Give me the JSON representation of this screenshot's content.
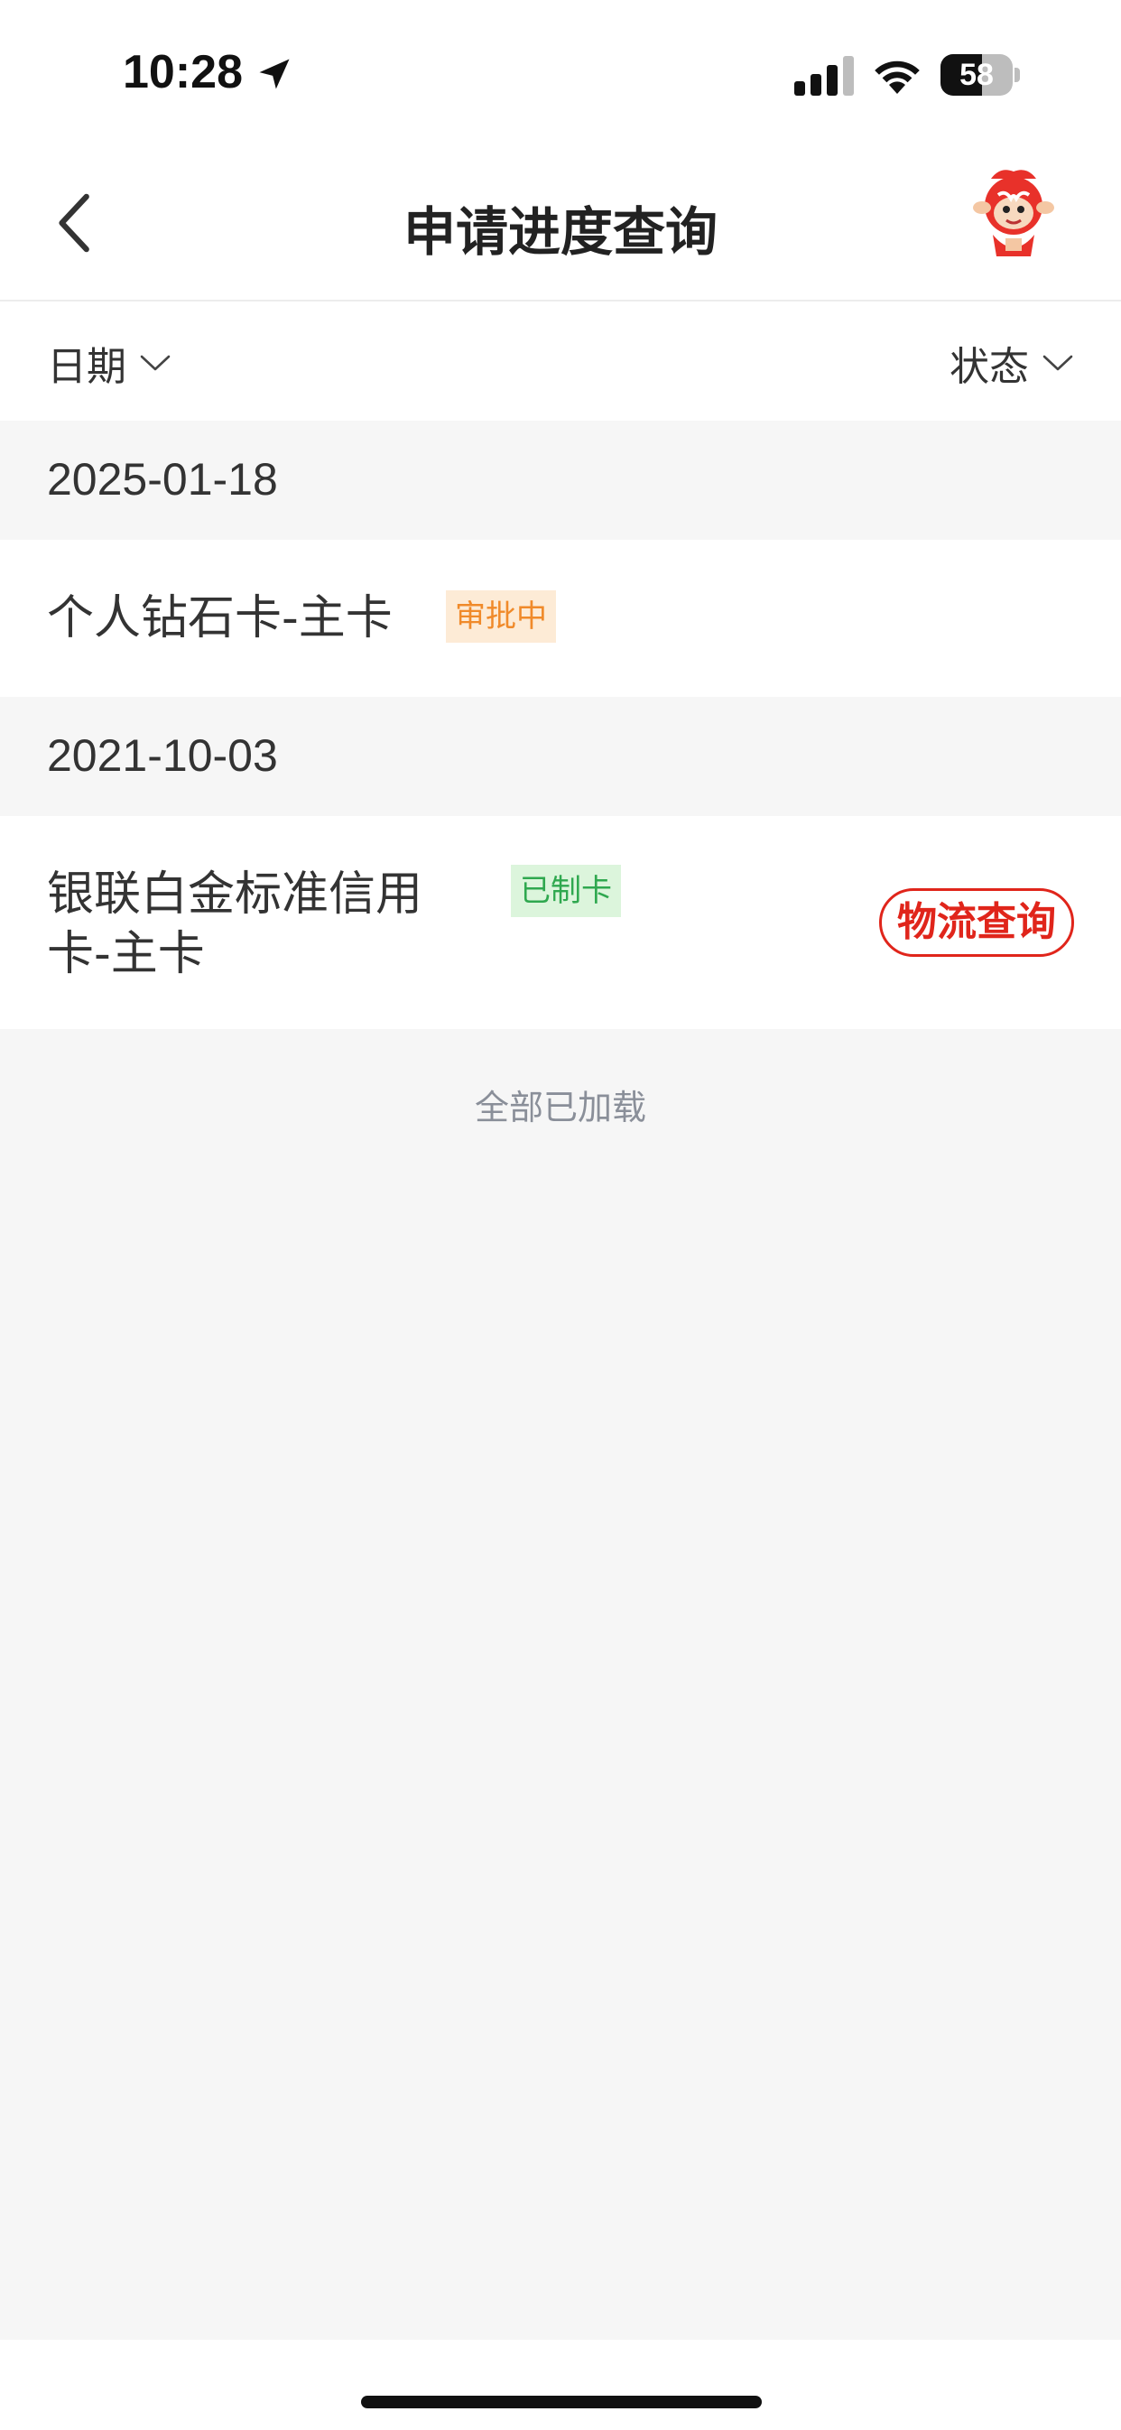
{
  "status_bar": {
    "time": "10:28",
    "battery_level": 58,
    "battery_text": "58",
    "icons": [
      "location-arrow-icon",
      "signal-icon",
      "wifi-icon",
      "battery-icon"
    ]
  },
  "nav": {
    "title": "申请进度查询",
    "back_icon": "chevron-left-icon",
    "avatar_icon": "mascot-avatar"
  },
  "filters": {
    "date_label": "日期",
    "status_label": "状态",
    "dropdown_icon": "chevron-down-icon"
  },
  "groups": [
    {
      "date": "2025-01-18",
      "items": [
        {
          "name": "个人钻石卡-主卡",
          "status": "审批中",
          "status_color": "#f08a2a"
        }
      ]
    },
    {
      "date": "2021-10-03",
      "items": [
        {
          "name_line1": "银联白金标准信用",
          "name_line2": "卡-主卡",
          "status": "已制卡",
          "status_color": "#2fa84f",
          "action_label": "物流查询"
        }
      ]
    }
  ],
  "footer": {
    "end_text": "全部已加载"
  },
  "colors": {
    "accent_red": "#e0251b",
    "background": "#f6f6f6"
  }
}
